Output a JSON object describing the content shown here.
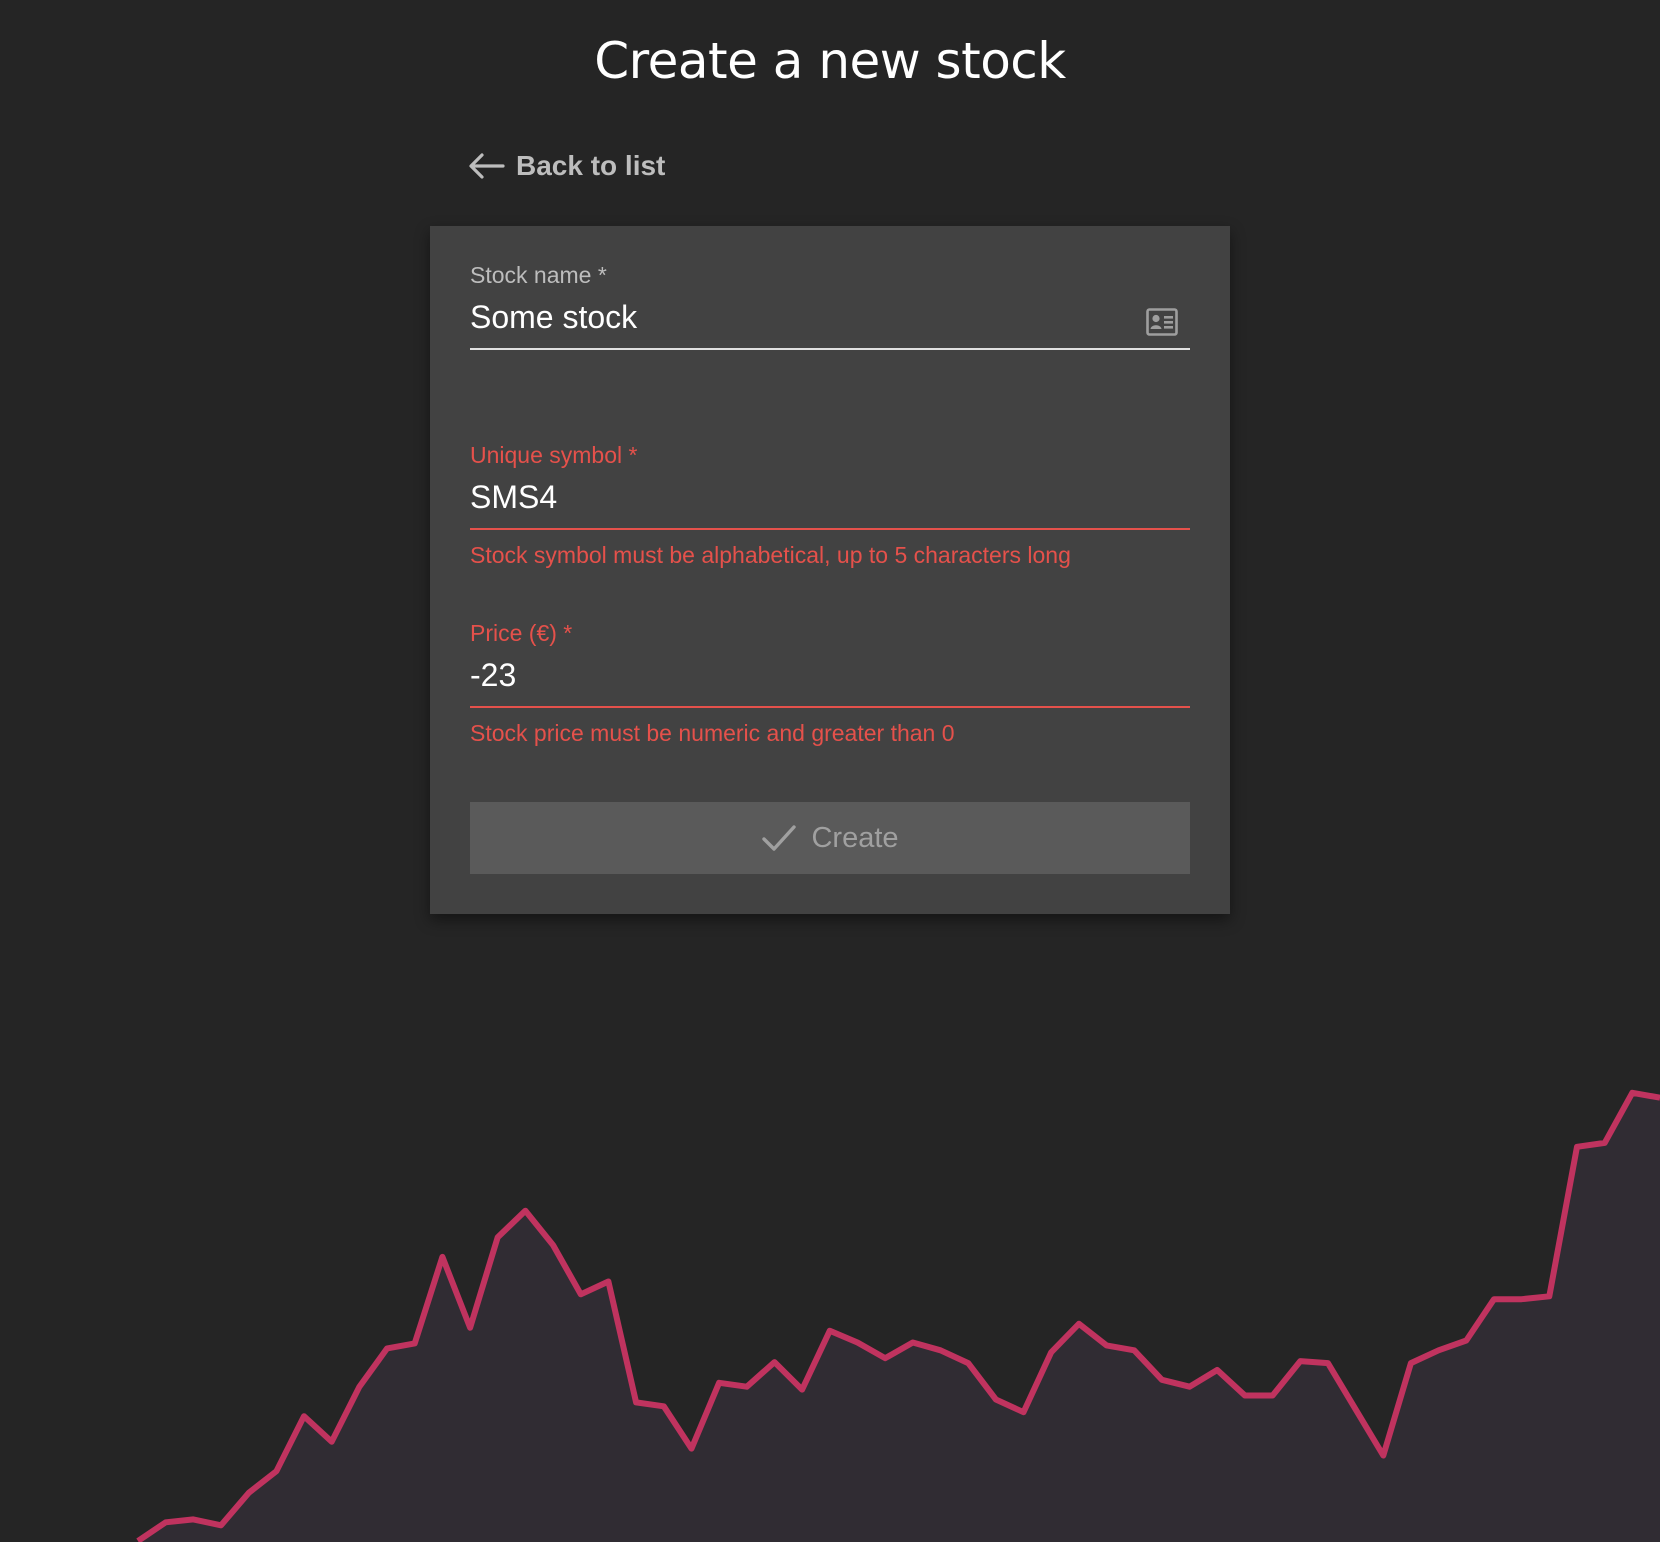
{
  "header": {
    "title": "Create a new stock"
  },
  "nav": {
    "back_label": "Back to list",
    "back_icon": "arrow-left-icon"
  },
  "form": {
    "stock_name": {
      "label": "Stock name *",
      "value": "Some stock",
      "icon": "contact-card-icon"
    },
    "symbol": {
      "label": "Unique symbol *",
      "value": "SMS4",
      "error": "Stock symbol must be alphabetical, up to 5 characters long"
    },
    "price": {
      "label": "Price (€) *",
      "value": "-23",
      "error": "Stock price must be numeric and greater than 0"
    },
    "submit": {
      "label": "Create",
      "icon": "check-icon",
      "disabled": true
    }
  },
  "colors": {
    "background": "#252525",
    "card": "#424242",
    "error": "#e5514b",
    "chart_line": "#c0335f",
    "chart_fill": "#302c33"
  },
  "background_chart": {
    "values": [
      1,
      20,
      23,
      17,
      50,
      72,
      128,
      102,
      158,
      197,
      202,
      290,
      218,
      310,
      337,
      302,
      252,
      265,
      142,
      138,
      95,
      162,
      158,
      183,
      155,
      215,
      203,
      187,
      203,
      195,
      182,
      145,
      132,
      193,
      222,
      200,
      195,
      165,
      158,
      175,
      149,
      149,
      184,
      182,
      135,
      88,
      182,
      195,
      205,
      247,
      247,
      250,
      402,
      406,
      457,
      452
    ]
  }
}
